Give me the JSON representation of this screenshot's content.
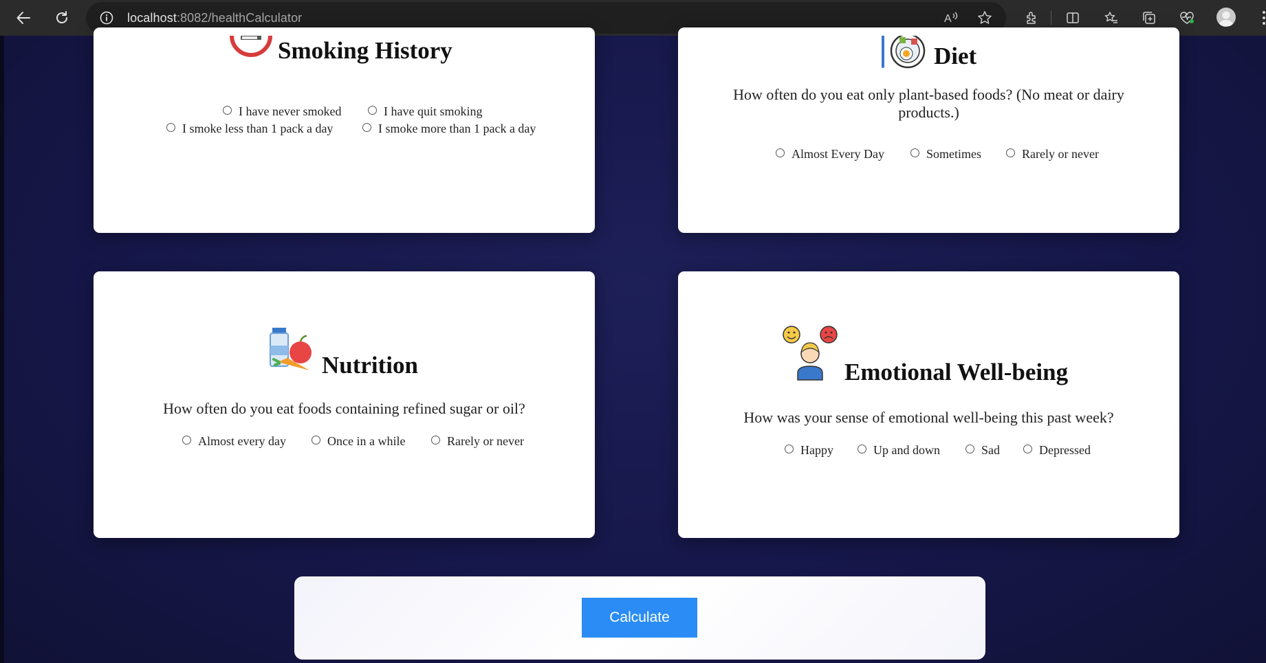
{
  "browser": {
    "url_host": "localhost",
    "url_path": ":8082/healthCalculator"
  },
  "cards": {
    "smoking": {
      "title": "Smoking History",
      "options": [
        "I have never smoked",
        "I have quit smoking",
        "I smoke less than 1 pack a day",
        "I smoke more than 1 pack a day"
      ]
    },
    "diet": {
      "title": "Diet",
      "question": "How often do you eat only plant-based foods? (No meat or dairy products.)",
      "options": [
        "Almost Every Day",
        "Sometimes",
        "Rarely or never"
      ]
    },
    "nutrition": {
      "title": "Nutrition",
      "question": "How often do you eat foods containing refined sugar or oil?",
      "options": [
        "Almost every day",
        "Once in a while",
        "Rarely or never"
      ]
    },
    "emotional": {
      "title": "Emotional Well-being",
      "question": "How was your sense of emotional well-being this past week?",
      "options": [
        "Happy",
        "Up and down",
        "Sad",
        "Depressed"
      ]
    }
  },
  "calculate_label": "Calculate",
  "colors": {
    "page_background": "#161844",
    "card_background": "#ffffff",
    "button_accent": "#2a8cf4"
  }
}
